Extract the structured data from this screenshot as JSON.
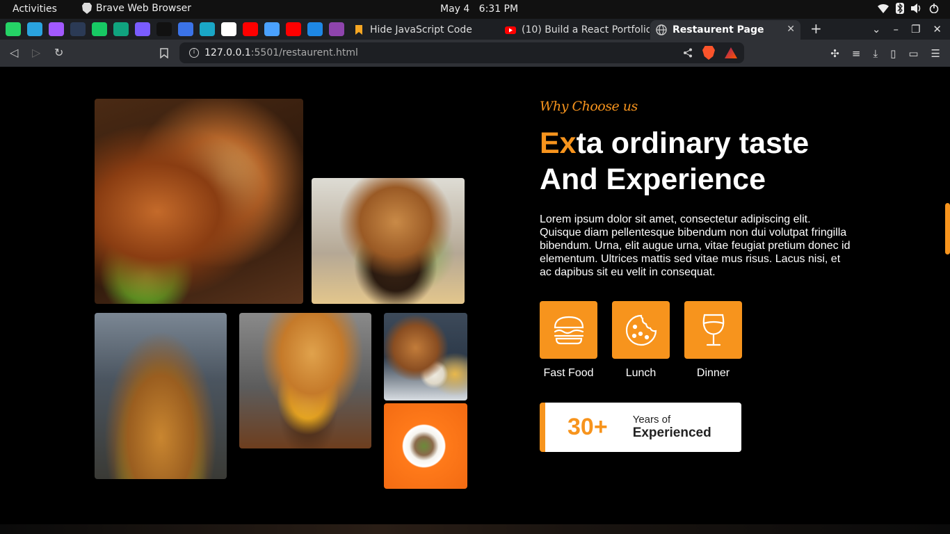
{
  "system_bar": {
    "activities": "Activities",
    "app_name": "Brave Web Browser",
    "date": "May 4",
    "time": "6:31 PM"
  },
  "tabs": [
    {
      "label": "Hide JavaScript Code",
      "icon": "bookmark-icon",
      "color": "#f5a623"
    },
    {
      "label": "(10) Build a React Portfolio",
      "icon": "youtube-icon",
      "color": "#ff0000"
    },
    {
      "label": "Restaurent Page",
      "icon": "globe-icon",
      "active": true
    }
  ],
  "pinned_tabs": [
    {
      "name": "whatsapp-icon",
      "color": "#25d366"
    },
    {
      "name": "telegram-icon",
      "color": "#2aa3df"
    },
    {
      "name": "figma-icon",
      "color": "#a259ff"
    },
    {
      "name": "game-icon",
      "color": "#2b3a55"
    },
    {
      "name": "app-icon",
      "color": "#17c964"
    },
    {
      "name": "chatgpt-icon",
      "color": "#10a37f"
    },
    {
      "name": "messenger-icon",
      "color": "#7a5cff"
    },
    {
      "name": "r-icon",
      "color": "#111111"
    },
    {
      "name": "docs-icon",
      "color": "#3b73e8"
    },
    {
      "name": "play-icon",
      "color": "#1aa7c7"
    },
    {
      "name": "f-icon",
      "color": "#ffffff"
    },
    {
      "name": "youtube-icon",
      "color": "#ff0000"
    },
    {
      "name": "plane-icon",
      "color": "#4aa1ff"
    },
    {
      "name": "youtube-icon",
      "color": "#ff0000"
    },
    {
      "name": "arrow-icon",
      "color": "#1e88e5"
    },
    {
      "name": "u-icon",
      "color": "#8e44ad"
    }
  ],
  "url": {
    "host": "127.0.0.1",
    "path": ":5501/restaurent.html"
  },
  "page": {
    "eyebrow": "Why Choose us",
    "headline_accent": "Ex",
    "headline_rest": "ta ordinary taste",
    "headline_line2": "And Experience",
    "paragraph": "Lorem ipsum dolor sit amet, consectetur adipiscing elit. Quisque diam pellentesque bibendum non dui volutpat fringilla bibendum. Urna, elit augue urna, vitae feugiat pretium donec id elementum. Ultrices mattis sed vitae mus risus. Lacus nisi, et ac dapibus sit eu velit in consequat.",
    "categories": [
      {
        "label": "Fast Food",
        "icon": "burger-icon"
      },
      {
        "label": "Lunch",
        "icon": "cookie-icon"
      },
      {
        "label": "Dinner",
        "icon": "wine-glass-icon"
      }
    ],
    "experience": {
      "number": "30+",
      "line1": "Years of",
      "line2": "Experienced"
    },
    "accent_color": "#f7941d"
  }
}
